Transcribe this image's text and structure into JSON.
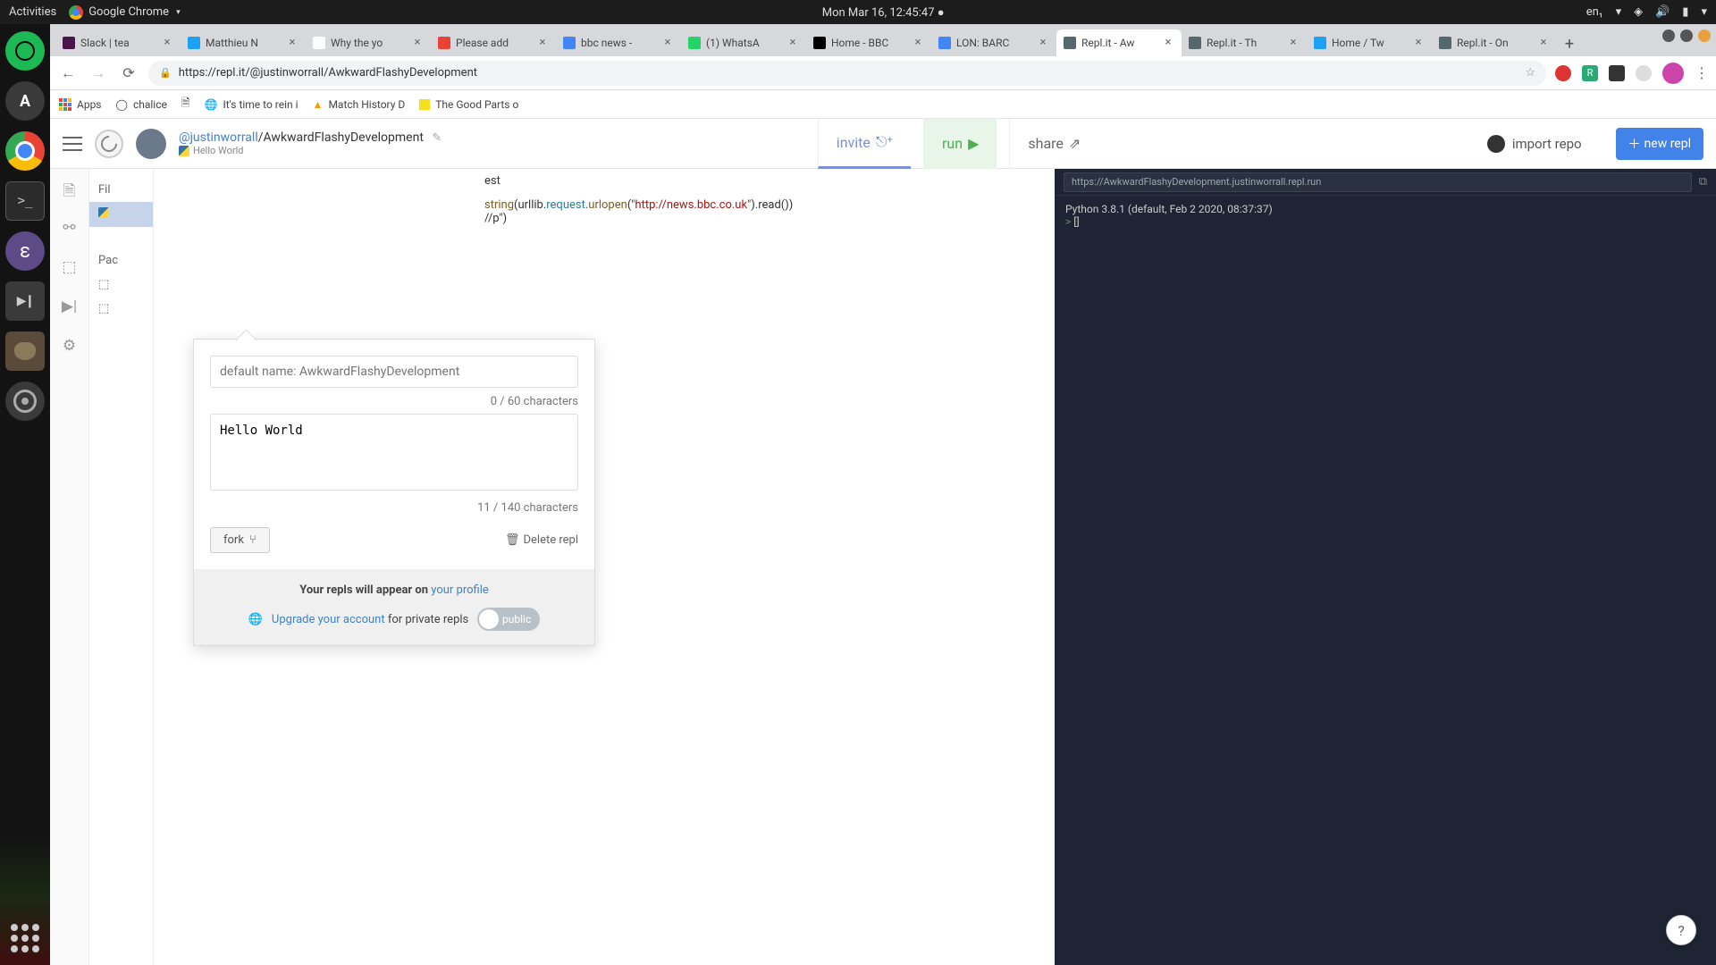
{
  "gnome": {
    "activities": "Activities",
    "app": "Google Chrome",
    "clock": "Mon Mar 16, 12:45:47",
    "lang": "en₁"
  },
  "tabs": [
    {
      "title": "Slack | tea",
      "favicon": "#4a154b"
    },
    {
      "title": "Matthieu N",
      "favicon": "#1da1f2"
    },
    {
      "title": "Why the yo",
      "favicon": "#ffffff"
    },
    {
      "title": "Please add",
      "favicon": "#ea4335"
    },
    {
      "title": "bbc news -",
      "favicon": "#4285f4"
    },
    {
      "title": "(1) WhatsA",
      "favicon": "#25d366"
    },
    {
      "title": "Home - BBC",
      "favicon": "#000000"
    },
    {
      "title": "LON: BARC",
      "favicon": "#4285f4"
    },
    {
      "title": "Repl.it - Aw",
      "favicon": "#56676e",
      "active": true
    },
    {
      "title": "Repl.it - Th",
      "favicon": "#56676e"
    },
    {
      "title": "Home / Tw",
      "favicon": "#1da1f2"
    },
    {
      "title": "Repl.it - On",
      "favicon": "#56676e"
    }
  ],
  "url": "https://repl.it/@justinworrall/AwkwardFlashyDevelopment",
  "bookmarks": {
    "apps": "Apps",
    "items": [
      "chalice",
      "",
      "It's time to rein i",
      "Match History D",
      "The Good Parts o"
    ]
  },
  "breadcrumb": {
    "user": "@justinworrall",
    "repo": "/AwkwardFlashyDevelopment",
    "sub": "Hello World"
  },
  "header_buttons": {
    "invite": "invite",
    "run": "run",
    "share": "share",
    "import": "import repo",
    "new_repl": "new repl"
  },
  "sidebar": {
    "files": "Fil",
    "packages": "Pac"
  },
  "popover": {
    "name_placeholder": "default name: AwkwardFlashyDevelopment",
    "name_counter": "0 / 60 characters",
    "desc_value": "Hello World",
    "desc_counter": "11 / 140 characters",
    "fork": "fork",
    "delete": "Delete repl",
    "footer_text": "Your repls will appear on ",
    "footer_link": "your profile",
    "upgrade_link": "Upgrade your account",
    "upgrade_suffix": " for private repls",
    "toggle": "public"
  },
  "editor": {
    "frag1": "est",
    "frag2_pre": "string",
    "frag2_mid": "(urllib.",
    "frag2_fn": "request",
    "frag2_dot": ".",
    "frag2_fn2": "urlopen",
    "frag2_open": "(",
    "frag2_str": "\"http://news.bbc.co.uk\"",
    "frag2_end": ").read())",
    "frag3": "//p\")"
  },
  "terminal": {
    "url": "https://AwkwardFlashyDevelopment.justinworrall.repl.run",
    "line1": "Python 3.8.1 (default, Feb  2 2020, 08:37:37)",
    "prompt": ">",
    "cursor": "[]"
  },
  "help": "?"
}
